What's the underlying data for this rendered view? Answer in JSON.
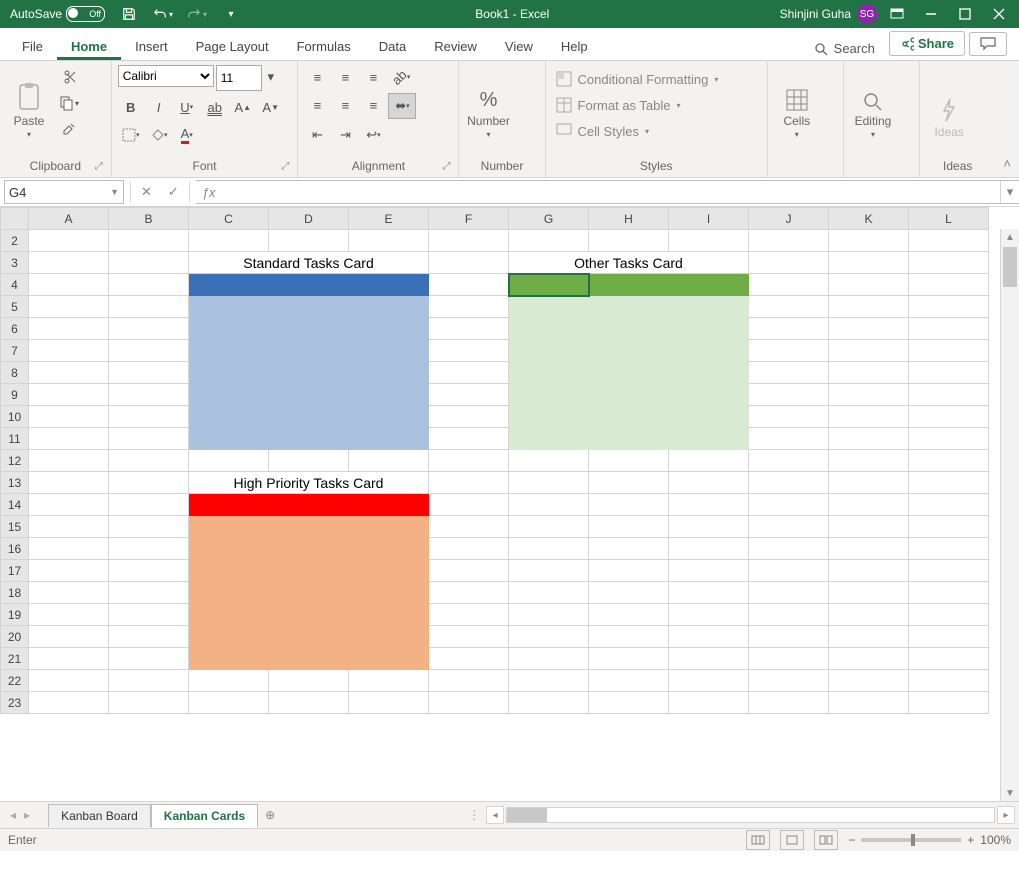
{
  "titlebar": {
    "autosave_label": "AutoSave",
    "autosave_state": "Off",
    "doc_title": "Book1  -  Excel",
    "user_name": "Shinjini Guha",
    "user_initials": "SG"
  },
  "tabs": {
    "file": "File",
    "home": "Home",
    "insert": "Insert",
    "layout": "Page Layout",
    "formulas": "Formulas",
    "data": "Data",
    "review": "Review",
    "view": "View",
    "help": "Help",
    "search": "Search",
    "share": "Share"
  },
  "ribbon": {
    "clipboard": {
      "paste": "Paste",
      "label": "Clipboard"
    },
    "font": {
      "name": "Calibri",
      "size": "11",
      "label": "Font"
    },
    "alignment": {
      "label": "Alignment"
    },
    "number": {
      "big": "Number",
      "label": "Number",
      "percent": "%"
    },
    "styles": {
      "cond": "Conditional Formatting",
      "table": "Format as Table",
      "cell": "Cell Styles",
      "label": "Styles"
    },
    "cells": {
      "big": "Cells",
      "label": ""
    },
    "editing": {
      "big": "Editing",
      "label": ""
    },
    "ideas": {
      "big": "Ideas",
      "label": "Ideas"
    }
  },
  "namebox": "G4",
  "columns": [
    "A",
    "B",
    "C",
    "D",
    "E",
    "F",
    "G",
    "H",
    "I",
    "J",
    "K",
    "L"
  ],
  "rows": [
    2,
    3,
    4,
    5,
    6,
    7,
    8,
    9,
    10,
    11,
    12,
    13,
    14,
    15,
    16,
    17,
    18,
    19,
    20,
    21,
    22,
    23
  ],
  "cards": {
    "standard": {
      "title": "Standard Tasks Card",
      "header_color": "#3b6fb6",
      "body_color": "#aac1e0",
      "pos": {
        "col_start": 3,
        "col_end": 5,
        "row_title": 3,
        "row_header": 4,
        "row_body_start": 5,
        "row_body_end": 11
      }
    },
    "other": {
      "title": "Other Tasks Card",
      "header_color": "#70ad47",
      "body_color": "#d9ead3",
      "pos": {
        "col_start": 7,
        "col_end": 9,
        "row_title": 3,
        "row_header": 4,
        "row_body_start": 5,
        "row_body_end": 11
      }
    },
    "high": {
      "title": "High Priority Tasks Card",
      "header_color": "#ff0000",
      "body_color": "#f4b183",
      "pos": {
        "col_start": 3,
        "col_end": 5,
        "row_title": 13,
        "row_header": 14,
        "row_body_start": 15,
        "row_body_end": 21
      }
    }
  },
  "selected_cell": {
    "col": 7,
    "row": 4
  },
  "sheet_tabs": {
    "inactive": "Kanban Board",
    "active": "Kanban Cards"
  },
  "status": {
    "mode": "Enter",
    "zoom": "100%"
  }
}
